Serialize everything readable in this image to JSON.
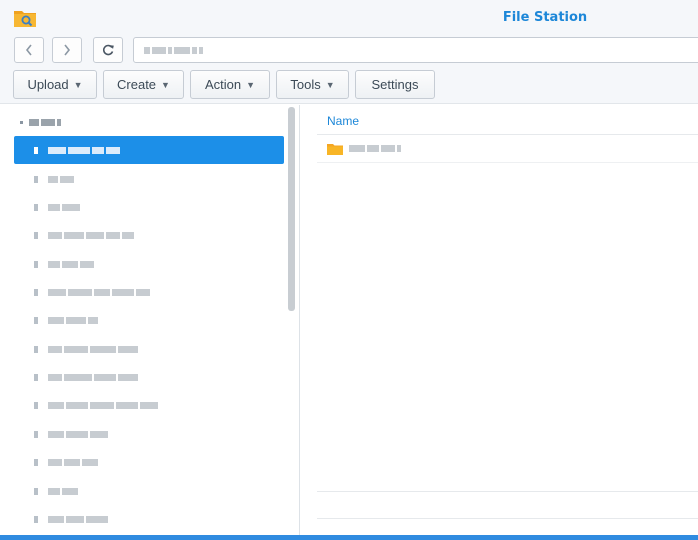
{
  "app": {
    "title": "File Station",
    "icon": "file-station-icon",
    "accent_color": "#1d87d8",
    "selection_color": "#1c8fe8"
  },
  "nav": {
    "back_icon": "chevron-left-icon",
    "forward_icon": "chevron-right-icon",
    "refresh_icon": "refresh-icon"
  },
  "toolbar": {
    "upload_label": "Upload",
    "create_label": "Create",
    "action_label": "Action",
    "tools_label": "Tools",
    "settings_label": "Settings"
  },
  "main": {
    "columns": [
      "Name"
    ],
    "rows": [
      {
        "type": "folder",
        "icon": "folder-icon"
      }
    ]
  }
}
